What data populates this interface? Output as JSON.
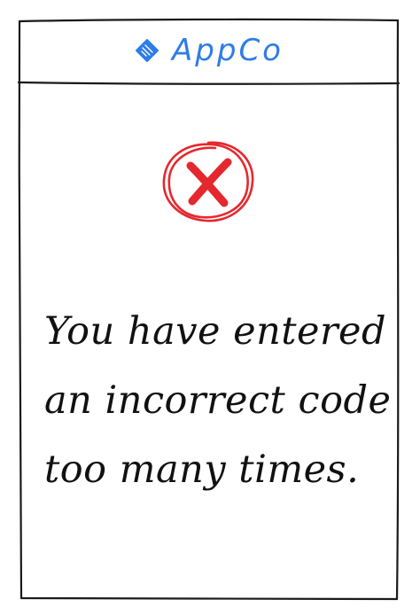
{
  "colors": {
    "brand": "#2e7ce8",
    "error": "#e5282e",
    "ink": "#111111"
  },
  "header": {
    "logo_icon": "diamond-logo-icon",
    "brand_name": "AppCo"
  },
  "status": {
    "icon": "error-x-icon"
  },
  "message": {
    "lines": [
      "You have entered",
      "an incorrect code",
      "too many times."
    ]
  }
}
